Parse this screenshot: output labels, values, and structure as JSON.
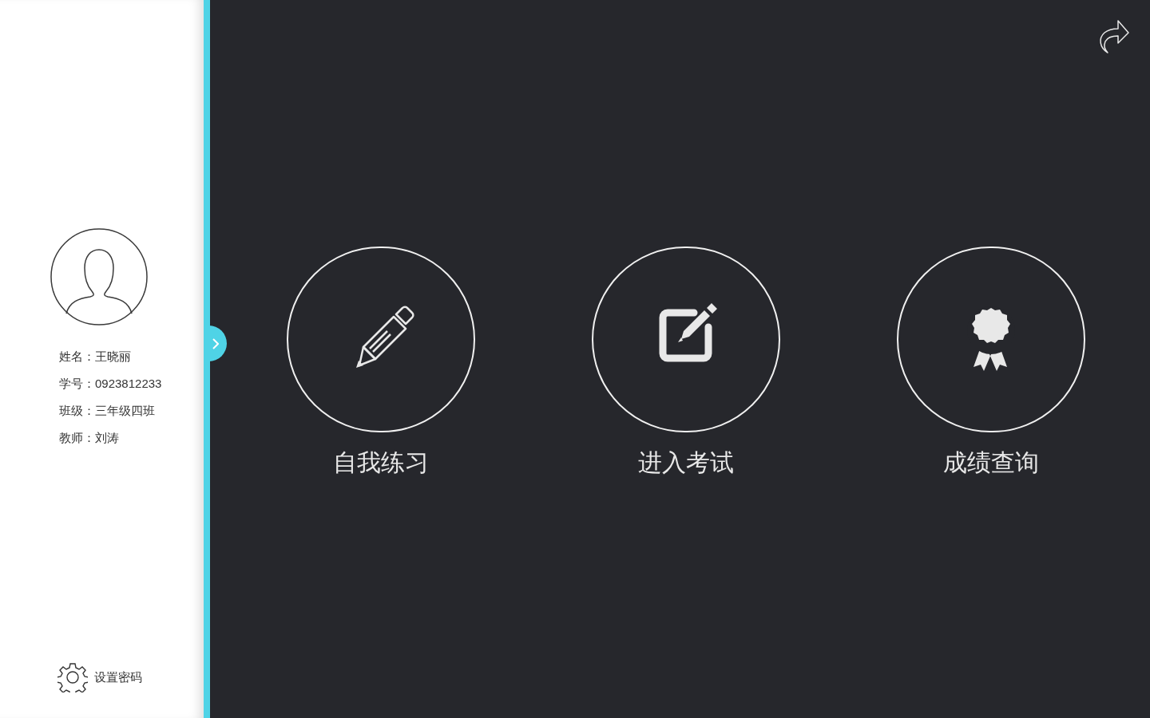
{
  "sidebar": {
    "profile": [
      "姓名：王晓丽",
      "学号：0923812233",
      "班级：三年级四班",
      "教师：刘涛"
    ],
    "settings_link": "设置密码"
  },
  "actions": [
    {
      "kind": "pencil",
      "label": "自我练习"
    },
    {
      "kind": "edit",
      "label": "进入考试"
    },
    {
      "kind": "award",
      "label": "成绩查询"
    }
  ]
}
